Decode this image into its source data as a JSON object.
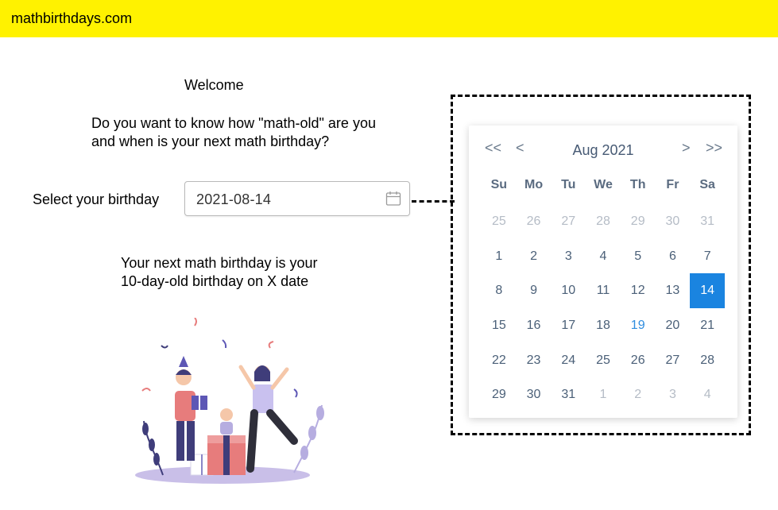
{
  "site": {
    "title": "mathbirthdays.com"
  },
  "welcome": "Welcome",
  "question": {
    "line1": "Do you want to know how \"math-old\" are you",
    "line2": "and when is your next math birthday?"
  },
  "birthday": {
    "label": "Select your birthday",
    "value": "2021-08-14"
  },
  "result": {
    "line1": "Your next math birthday is your",
    "line2": "10-day-old birthday on X date"
  },
  "calendar": {
    "prev_year": "<<",
    "prev_month": "<",
    "title": "Aug  2021",
    "next_month": ">",
    "next_year": ">>",
    "weekdays": [
      "Su",
      "Mo",
      "Tu",
      "We",
      "Th",
      "Fr",
      "Sa"
    ],
    "days": [
      {
        "label": "25",
        "state": "other"
      },
      {
        "label": "26",
        "state": "other"
      },
      {
        "label": "27",
        "state": "other"
      },
      {
        "label": "28",
        "state": "other"
      },
      {
        "label": "29",
        "state": "other"
      },
      {
        "label": "30",
        "state": "other"
      },
      {
        "label": "31",
        "state": "other"
      },
      {
        "label": "1",
        "state": "current"
      },
      {
        "label": "2",
        "state": "current"
      },
      {
        "label": "3",
        "state": "current"
      },
      {
        "label": "4",
        "state": "current"
      },
      {
        "label": "5",
        "state": "current"
      },
      {
        "label": "6",
        "state": "current"
      },
      {
        "label": "7",
        "state": "current"
      },
      {
        "label": "8",
        "state": "current"
      },
      {
        "label": "9",
        "state": "current"
      },
      {
        "label": "10",
        "state": "current"
      },
      {
        "label": "11",
        "state": "current"
      },
      {
        "label": "12",
        "state": "current"
      },
      {
        "label": "13",
        "state": "current"
      },
      {
        "label": "14",
        "state": "selected"
      },
      {
        "label": "15",
        "state": "current"
      },
      {
        "label": "16",
        "state": "current"
      },
      {
        "label": "17",
        "state": "current"
      },
      {
        "label": "18",
        "state": "current"
      },
      {
        "label": "19",
        "state": "today"
      },
      {
        "label": "20",
        "state": "current"
      },
      {
        "label": "21",
        "state": "current"
      },
      {
        "label": "22",
        "state": "current"
      },
      {
        "label": "23",
        "state": "current"
      },
      {
        "label": "24",
        "state": "current"
      },
      {
        "label": "25",
        "state": "current"
      },
      {
        "label": "26",
        "state": "current"
      },
      {
        "label": "27",
        "state": "current"
      },
      {
        "label": "28",
        "state": "current"
      },
      {
        "label": "29",
        "state": "current"
      },
      {
        "label": "30",
        "state": "current"
      },
      {
        "label": "31",
        "state": "current"
      },
      {
        "label": "1",
        "state": "other"
      },
      {
        "label": "2",
        "state": "other"
      },
      {
        "label": "3",
        "state": "other"
      },
      {
        "label": "4",
        "state": "other"
      }
    ],
    "colors": {
      "selected": "#1a84e0",
      "today": "#2f8ddf",
      "day": "#4b6078",
      "other": "#b5bcc6"
    }
  },
  "icons": {
    "date_input": "calendar-icon"
  },
  "colors": {
    "header_bg": "#fff200"
  }
}
